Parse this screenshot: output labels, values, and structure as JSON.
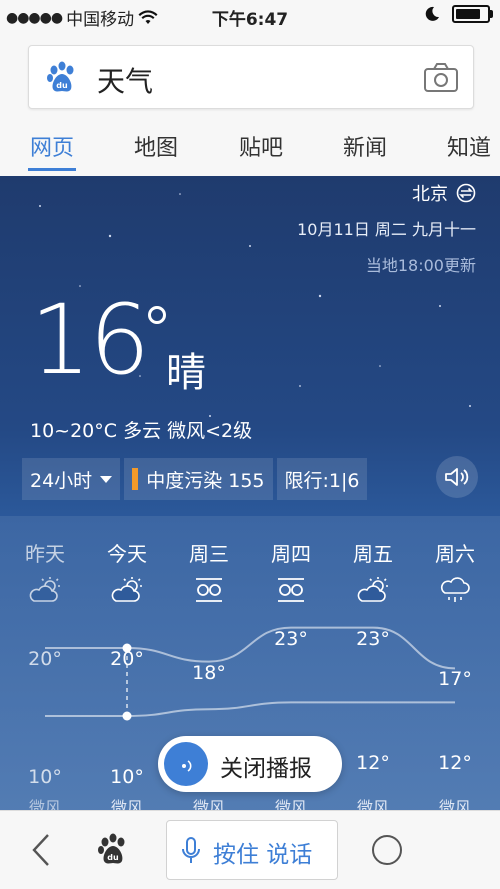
{
  "statusbar": {
    "carrier": "中国移动",
    "time": "下午6:47"
  },
  "search": {
    "query": "天气"
  },
  "tabs": [
    {
      "label": "网页"
    },
    {
      "label": "地图"
    },
    {
      "label": "贴吧"
    },
    {
      "label": "新闻"
    },
    {
      "label": "知道"
    }
  ],
  "weather": {
    "city": "北京",
    "date": "10月11日 周二 九月十一",
    "update": "当地18:00更新",
    "temperature": "16",
    "condition": "晴",
    "summary": "10~20°C  多云  微风<2级",
    "chip_hours": "24小时",
    "chip_pollution": "中度污染 155",
    "chip_restrict": "限行:1|6"
  },
  "forecast": {
    "days": [
      {
        "name": "昨天",
        "icon": "partly-cloudy-icon",
        "high": "20°",
        "low": "10°",
        "wind": "微风"
      },
      {
        "name": "今天",
        "icon": "partly-cloudy-icon",
        "high": "20°",
        "low": "10°",
        "wind": "微风"
      },
      {
        "name": "周三",
        "icon": "haze-icon",
        "high": "18°",
        "low": "",
        "wind": "微风"
      },
      {
        "name": "周四",
        "icon": "haze-icon",
        "high": "23°",
        "low": "",
        "wind": "微风"
      },
      {
        "name": "周五",
        "icon": "partly-cloudy-icon",
        "high": "23°",
        "low": "12°",
        "wind": "微风"
      },
      {
        "name": "周六",
        "icon": "rain-icon",
        "high": "17°",
        "low": "12°",
        "wind": "微风"
      }
    ],
    "highs": [
      20,
      20,
      18,
      23,
      23,
      17
    ],
    "lows": [
      10,
      10,
      11,
      12,
      12,
      12
    ]
  },
  "pill": {
    "label": "关闭播报"
  },
  "bottombar": {
    "voice_label": "按住 说话"
  },
  "colors": {
    "accent": "#3e7fd6",
    "pollution": "#f39a2a"
  }
}
